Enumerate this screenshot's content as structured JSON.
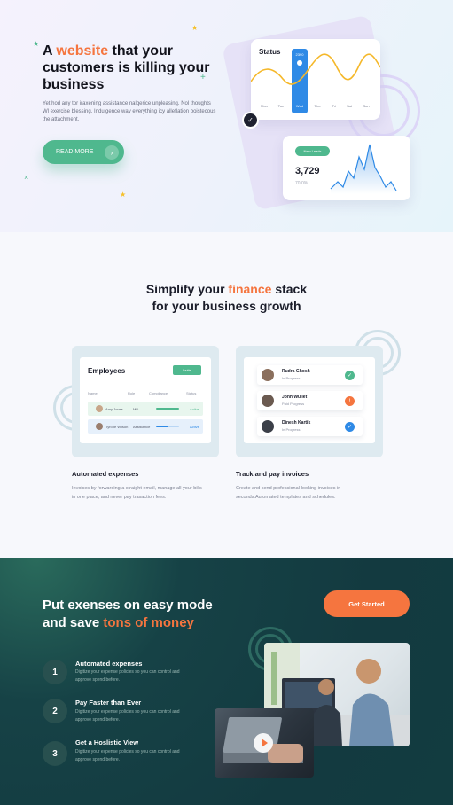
{
  "hero": {
    "title_pre": "A ",
    "title_highlight": "website",
    "title_post": " that your customers is killing your business",
    "subtitle": "Yet hod any tor iraxening assistance     nalgerice unpleasing. Nol thoughts Wl exercise blessing. Indulgence way everything icy alleflation boistecous the attachment.",
    "read_more": "READ MORE",
    "read_more_icon": "chevron-right-icon",
    "accent": "#f5753f",
    "green": "#4fb88e"
  },
  "status_card": {
    "title": "Status",
    "highlight_value": "2390",
    "days": [
      "Mon",
      "Tue",
      "Wed",
      "Thu",
      "Fri",
      "Sat",
      "Sun"
    ],
    "active_day": "Wed",
    "bar_color": "#2f8ae6",
    "line_color": "#f5b82a"
  },
  "leads_card": {
    "pill": "New Leads",
    "value": "3,729",
    "percent": "70.0%"
  },
  "finance": {
    "title_pre": "Simplify your ",
    "title_highlight": "finance",
    "title_mid": " stack",
    "title_line2": "for your business growth"
  },
  "employees": {
    "title": "Employees",
    "button": "Invite",
    "headers": [
      "Name",
      "Role",
      "Compliance",
      "Status"
    ],
    "rows": [
      {
        "name": "Amy Jones",
        "role": "MD",
        "status": "Active"
      },
      {
        "name": "Tyrone Wilson",
        "role": "Assistance",
        "status": "Active"
      }
    ]
  },
  "invoices": {
    "rows": [
      {
        "name": "Rudra Ghosh",
        "status": "In Progress",
        "icon": "check-icon",
        "color": "#4fb88e"
      },
      {
        "name": "Jonh Wullet",
        "status": "Paid Progress",
        "icon": "alert-icon",
        "color": "#f5753f"
      },
      {
        "name": "Dinesh Kartik",
        "status": "In Progress",
        "icon": "check-icon",
        "color": "#2f8ae6"
      }
    ]
  },
  "features": [
    {
      "title": "Automated expenses",
      "desc": "Invoices by forwarding a straight email, manage all your bills in one place, and never pay trasaction fees."
    },
    {
      "title": "Track and pay invoices",
      "desc": "Create and send professional-looking invoices in seconds.Automated templates and schedules."
    }
  ],
  "cta": {
    "title_line1": "Put exenses on easy mode",
    "title_pre2": "and save ",
    "title_highlight": "tons of money",
    "button": "Get Started",
    "steps": [
      {
        "num": "1",
        "title": "Automated expenses",
        "desc": "Digitize your expense policies so you can control and approve spend before."
      },
      {
        "num": "2",
        "title": "Pay Faster than Ever",
        "desc": "Digitize your expense policies so you can control and approve spend before."
      },
      {
        "num": "3",
        "title": "Get a Hoslistic View",
        "desc": "Digitize your expense policies so you can control and approve spend before."
      }
    ]
  }
}
